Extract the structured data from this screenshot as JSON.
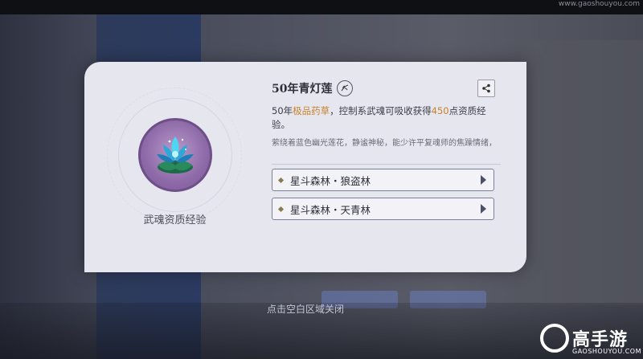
{
  "item": {
    "title": "50年青灯莲",
    "desc_prefix": "50年",
    "desc_quality": "极品药草",
    "desc_middle": "，控制系武魂可吸收获得",
    "desc_value": "450",
    "desc_suffix": "点资质经验。",
    "flavor": "萦绕着蓝色幽光莲花，静谧神秘，能少许平复魂师的焦躁情绪，",
    "category": "武魂资质经验"
  },
  "locations": [
    {
      "label": "星斗森林・狼盗林"
    },
    {
      "label": "星斗森林・天青林"
    }
  ],
  "hint": "点击空白区域关闭",
  "top_right_text": "www.gaoshouyou.com",
  "watermark": {
    "name": "高手游",
    "domain": "GAOSHOUYOU.COM"
  },
  "colors": {
    "highlight": "#c8832e",
    "card_bg": "#e6e6ee",
    "item_bg": "#8e6aa8"
  },
  "icons": {
    "herb": "herb-icon",
    "share": "share-icon",
    "arrow": "arrow-right-icon"
  }
}
